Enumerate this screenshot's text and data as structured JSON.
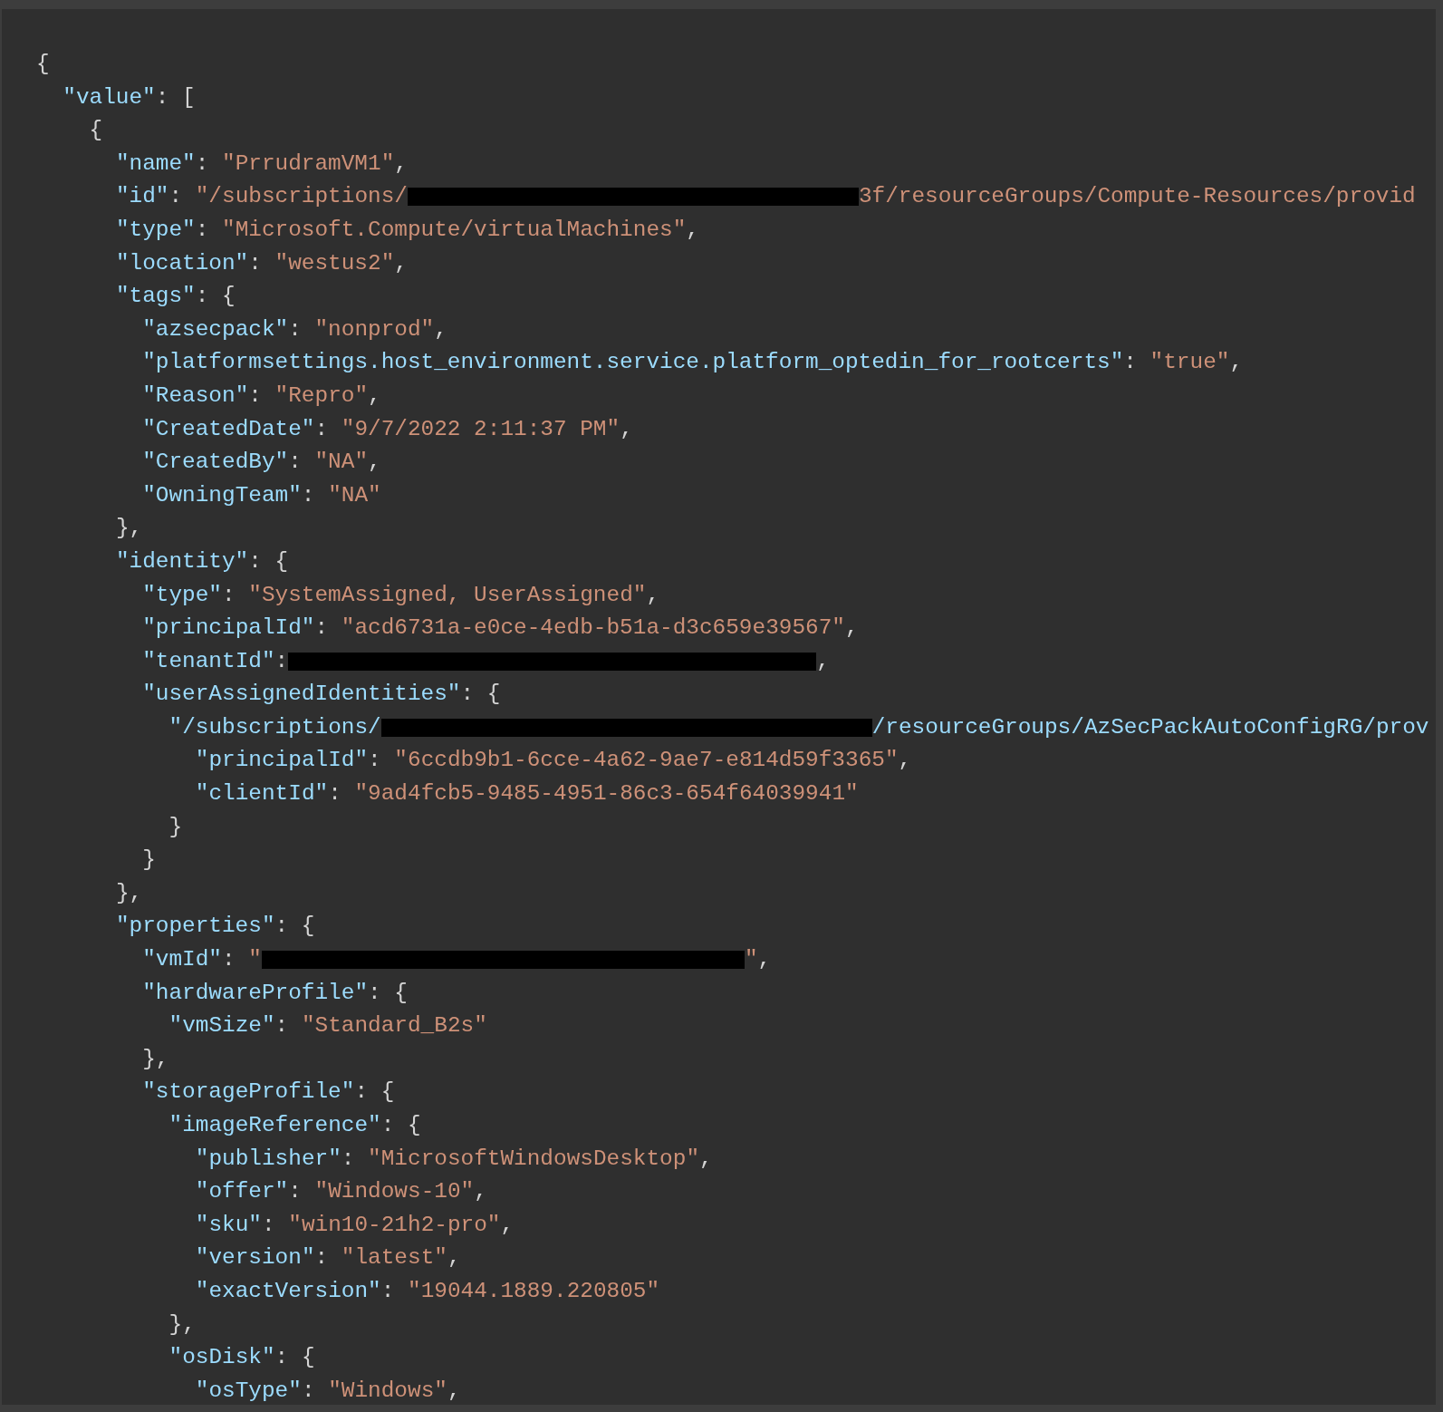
{
  "code_lines": [
    {
      "tokens": [
        {
          "kind": "punct",
          "text": "{"
        }
      ],
      "children": [
        {
          "tokens": [
            {
              "kind": "key",
              "text": "\"value\""
            },
            {
              "kind": "punct",
              "text": ": ["
            }
          ],
          "children": [
            {
              "tokens": [
                {
                  "kind": "punct",
                  "text": "{"
                }
              ],
              "children": [
                {
                  "tokens": [
                    {
                      "kind": "key",
                      "text": "\"name\""
                    },
                    {
                      "kind": "punct",
                      "text": ": "
                    },
                    {
                      "kind": "string",
                      "text": "\"PrrudramVM1\""
                    },
                    {
                      "kind": "punct",
                      "text": ","
                    }
                  ]
                },
                {
                  "tokens": [
                    {
                      "kind": "key",
                      "text": "\"id\""
                    },
                    {
                      "kind": "punct",
                      "text": ": "
                    },
                    {
                      "kind": "string",
                      "text": "\"/subscriptions/"
                    },
                    {
                      "kind": "redacted"
                    },
                    {
                      "kind": "string",
                      "text": "3f/resourceGroups/Compute-Resources/provid"
                    }
                  ]
                },
                {
                  "tokens": [
                    {
                      "kind": "key",
                      "text": "\"type\""
                    },
                    {
                      "kind": "punct",
                      "text": ": "
                    },
                    {
                      "kind": "string",
                      "text": "\"Microsoft.Compute/virtualMachines\""
                    },
                    {
                      "kind": "punct",
                      "text": ","
                    }
                  ]
                },
                {
                  "tokens": [
                    {
                      "kind": "key",
                      "text": "\"location\""
                    },
                    {
                      "kind": "punct",
                      "text": ": "
                    },
                    {
                      "kind": "string",
                      "text": "\"westus2\""
                    },
                    {
                      "kind": "punct",
                      "text": ","
                    }
                  ]
                },
                {
                  "tokens": [
                    {
                      "kind": "key",
                      "text": "\"tags\""
                    },
                    {
                      "kind": "punct",
                      "text": ": {"
                    }
                  ],
                  "children": [
                    {
                      "tokens": [
                        {
                          "kind": "key",
                          "text": "\"azsecpack\""
                        },
                        {
                          "kind": "punct",
                          "text": ": "
                        },
                        {
                          "kind": "string",
                          "text": "\"nonprod\""
                        },
                        {
                          "kind": "punct",
                          "text": ","
                        }
                      ]
                    },
                    {
                      "tokens": [
                        {
                          "kind": "key",
                          "text": "\"platformsettings.host_environment.service.platform_optedin_for_rootcerts\""
                        },
                        {
                          "kind": "punct",
                          "text": ": "
                        },
                        {
                          "kind": "string",
                          "text": "\"true\""
                        },
                        {
                          "kind": "punct",
                          "text": ","
                        }
                      ]
                    },
                    {
                      "tokens": [
                        {
                          "kind": "key",
                          "text": "\"Reason\""
                        },
                        {
                          "kind": "punct",
                          "text": ": "
                        },
                        {
                          "kind": "string",
                          "text": "\"Repro\""
                        },
                        {
                          "kind": "punct",
                          "text": ","
                        }
                      ]
                    },
                    {
                      "tokens": [
                        {
                          "kind": "key",
                          "text": "\"CreatedDate\""
                        },
                        {
                          "kind": "punct",
                          "text": ": "
                        },
                        {
                          "kind": "string",
                          "text": "\"9/7/2022 2:11:37 PM\""
                        },
                        {
                          "kind": "punct",
                          "text": ","
                        }
                      ]
                    },
                    {
                      "tokens": [
                        {
                          "kind": "key",
                          "text": "\"CreatedBy\""
                        },
                        {
                          "kind": "punct",
                          "text": ": "
                        },
                        {
                          "kind": "string",
                          "text": "\"NA\""
                        },
                        {
                          "kind": "punct",
                          "text": ","
                        }
                      ]
                    },
                    {
                      "tokens": [
                        {
                          "kind": "key",
                          "text": "\"OwningTeam\""
                        },
                        {
                          "kind": "punct",
                          "text": ": "
                        },
                        {
                          "kind": "string",
                          "text": "\"NA\""
                        }
                      ]
                    }
                  ]
                },
                {
                  "tokens": [
                    {
                      "kind": "punct",
                      "text": "},"
                    }
                  ]
                },
                {
                  "tokens": [
                    {
                      "kind": "key",
                      "text": "\"identity\""
                    },
                    {
                      "kind": "punct",
                      "text": ": {"
                    }
                  ],
                  "children": [
                    {
                      "tokens": [
                        {
                          "kind": "key",
                          "text": "\"type\""
                        },
                        {
                          "kind": "punct",
                          "text": ": "
                        },
                        {
                          "kind": "string",
                          "text": "\"SystemAssigned, UserAssigned\""
                        },
                        {
                          "kind": "punct",
                          "text": ","
                        }
                      ]
                    },
                    {
                      "tokens": [
                        {
                          "kind": "key",
                          "text": "\"principalId\""
                        },
                        {
                          "kind": "punct",
                          "text": ": "
                        },
                        {
                          "kind": "string",
                          "text": "\"acd6731a-e0ce-4edb-b51a-d3c659e39567\""
                        },
                        {
                          "kind": "punct",
                          "text": ","
                        }
                      ]
                    },
                    {
                      "tokens": [
                        {
                          "kind": "key",
                          "text": "\"tenantId\""
                        },
                        {
                          "kind": "punct",
                          "text": ":"
                        },
                        {
                          "kind": "redacted"
                        },
                        {
                          "kind": "punct",
                          "text": ","
                        }
                      ]
                    },
                    {
                      "tokens": [
                        {
                          "kind": "key",
                          "text": "\"userAssignedIdentities\""
                        },
                        {
                          "kind": "punct",
                          "text": ": {"
                        }
                      ],
                      "children": [
                        {
                          "tokens": [
                            {
                              "kind": "key",
                              "text": "\"/subscriptions/"
                            },
                            {
                              "kind": "redacted"
                            },
                            {
                              "kind": "key",
                              "text": "/resourceGroups/AzSecPackAutoConfigRG/prov"
                            }
                          ],
                          "children": [
                            {
                              "tokens": [
                                {
                                  "kind": "key",
                                  "text": "\"principalId\""
                                },
                                {
                                  "kind": "punct",
                                  "text": ": "
                                },
                                {
                                  "kind": "string",
                                  "text": "\"6ccdb9b1-6cce-4a62-9ae7-e814d59f3365\""
                                },
                                {
                                  "kind": "punct",
                                  "text": ","
                                }
                              ]
                            },
                            {
                              "tokens": [
                                {
                                  "kind": "key",
                                  "text": "\"clientId\""
                                },
                                {
                                  "kind": "punct",
                                  "text": ": "
                                },
                                {
                                  "kind": "string",
                                  "text": "\"9ad4fcb5-9485-4951-86c3-654f64039941\""
                                }
                              ]
                            }
                          ]
                        },
                        {
                          "tokens": [
                            {
                              "kind": "punct",
                              "text": "}"
                            }
                          ]
                        }
                      ]
                    },
                    {
                      "tokens": [
                        {
                          "kind": "punct",
                          "text": "}"
                        }
                      ]
                    }
                  ]
                },
                {
                  "tokens": [
                    {
                      "kind": "punct",
                      "text": "},"
                    }
                  ]
                },
                {
                  "tokens": [
                    {
                      "kind": "key",
                      "text": "\"properties\""
                    },
                    {
                      "kind": "punct",
                      "text": ": {"
                    }
                  ],
                  "children": [
                    {
                      "tokens": [
                        {
                          "kind": "key",
                          "text": "\"vmId\""
                        },
                        {
                          "kind": "punct",
                          "text": ": "
                        },
                        {
                          "kind": "string",
                          "text": "\""
                        },
                        {
                          "kind": "redacted"
                        },
                        {
                          "kind": "string",
                          "text": "\""
                        },
                        {
                          "kind": "punct",
                          "text": ","
                        }
                      ]
                    },
                    {
                      "tokens": [
                        {
                          "kind": "key",
                          "text": "\"hardwareProfile\""
                        },
                        {
                          "kind": "punct",
                          "text": ": {"
                        }
                      ],
                      "children": [
                        {
                          "tokens": [
                            {
                              "kind": "key",
                              "text": "\"vmSize\""
                            },
                            {
                              "kind": "punct",
                              "text": ": "
                            },
                            {
                              "kind": "string",
                              "text": "\"Standard_B2s\""
                            }
                          ]
                        }
                      ]
                    },
                    {
                      "tokens": [
                        {
                          "kind": "punct",
                          "text": "},"
                        }
                      ]
                    },
                    {
                      "tokens": [
                        {
                          "kind": "key",
                          "text": "\"storageProfile\""
                        },
                        {
                          "kind": "punct",
                          "text": ": {"
                        }
                      ],
                      "children": [
                        {
                          "tokens": [
                            {
                              "kind": "key",
                              "text": "\"imageReference\""
                            },
                            {
                              "kind": "punct",
                              "text": ": {"
                            }
                          ],
                          "children": [
                            {
                              "tokens": [
                                {
                                  "kind": "key",
                                  "text": "\"publisher\""
                                },
                                {
                                  "kind": "punct",
                                  "text": ": "
                                },
                                {
                                  "kind": "string",
                                  "text": "\"MicrosoftWindowsDesktop\""
                                },
                                {
                                  "kind": "punct",
                                  "text": ","
                                }
                              ]
                            },
                            {
                              "tokens": [
                                {
                                  "kind": "key",
                                  "text": "\"offer\""
                                },
                                {
                                  "kind": "punct",
                                  "text": ": "
                                },
                                {
                                  "kind": "string",
                                  "text": "\"Windows-10\""
                                },
                                {
                                  "kind": "punct",
                                  "text": ","
                                }
                              ]
                            },
                            {
                              "tokens": [
                                {
                                  "kind": "key",
                                  "text": "\"sku\""
                                },
                                {
                                  "kind": "punct",
                                  "text": ": "
                                },
                                {
                                  "kind": "string",
                                  "text": "\"win10-21h2-pro\""
                                },
                                {
                                  "kind": "punct",
                                  "text": ","
                                }
                              ]
                            },
                            {
                              "tokens": [
                                {
                                  "kind": "key",
                                  "text": "\"version\""
                                },
                                {
                                  "kind": "punct",
                                  "text": ": "
                                },
                                {
                                  "kind": "string",
                                  "text": "\"latest\""
                                },
                                {
                                  "kind": "punct",
                                  "text": ","
                                }
                              ]
                            },
                            {
                              "tokens": [
                                {
                                  "kind": "key",
                                  "text": "\"exactVersion\""
                                },
                                {
                                  "kind": "punct",
                                  "text": ": "
                                },
                                {
                                  "kind": "string",
                                  "text": "\"19044.1889.220805\""
                                }
                              ]
                            }
                          ]
                        },
                        {
                          "tokens": [
                            {
                              "kind": "punct",
                              "text": "},"
                            }
                          ]
                        },
                        {
                          "tokens": [
                            {
                              "kind": "key",
                              "text": "\"osDisk\""
                            },
                            {
                              "kind": "punct",
                              "text": ": {"
                            }
                          ],
                          "children": [
                            {
                              "tokens": [
                                {
                                  "kind": "key",
                                  "text": "\"osType\""
                                },
                                {
                                  "kind": "punct",
                                  "text": ": "
                                },
                                {
                                  "kind": "string",
                                  "text": "\"Windows\""
                                },
                                {
                                  "kind": "punct",
                                  "text": ","
                                }
                              ]
                            }
                          ]
                        }
                      ]
                    }
                  ]
                }
              ]
            }
          ]
        }
      ]
    }
  ]
}
